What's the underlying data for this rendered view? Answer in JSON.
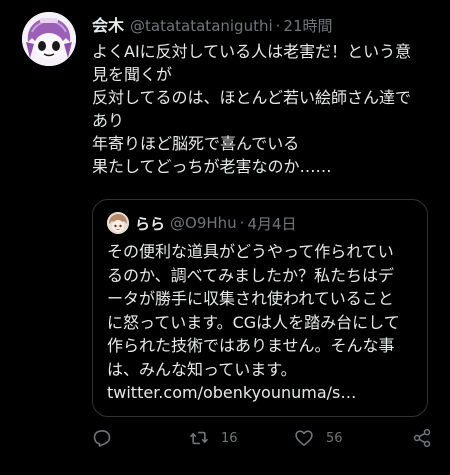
{
  "tweet": {
    "display_name": "会木",
    "handle": "@tatatatataniguthi",
    "separator": "·",
    "time": "21時間",
    "lines": [
      "よくAIに反対している人は老害だ！という意",
      "見を聞くが",
      "反対してるのは、ほとんど若い絵師さん達で",
      "あり",
      "年寄りほど脳死で喜んでいる",
      "果たしてどっちが老害なのか……"
    ]
  },
  "quote": {
    "display_name": "らら",
    "handle": "@O9Hhu",
    "separator": "·",
    "date": "4月4日",
    "lines": [
      "その便利な道具がどうやって作られてい",
      "るのか、調べてみましたか？私たちはデ",
      "ータが勝手に収集され使われていること",
      "に怒っています。CGは人を踏み台にして",
      "作られた技術ではありません。そんな事",
      "は、みんな知っています。",
      "twitter.com/obenkyounuma/s…"
    ]
  },
  "actions": {
    "reply_icon": "reply-icon",
    "retweet_icon": "retweet-icon",
    "retweet_count": "16",
    "like_icon": "heart-icon",
    "like_count": "56",
    "share_icon": "share-icon"
  },
  "colors": {
    "background": "#000000",
    "text": "#e7e9ea",
    "muted": "#71767b",
    "border": "#2f3336"
  }
}
